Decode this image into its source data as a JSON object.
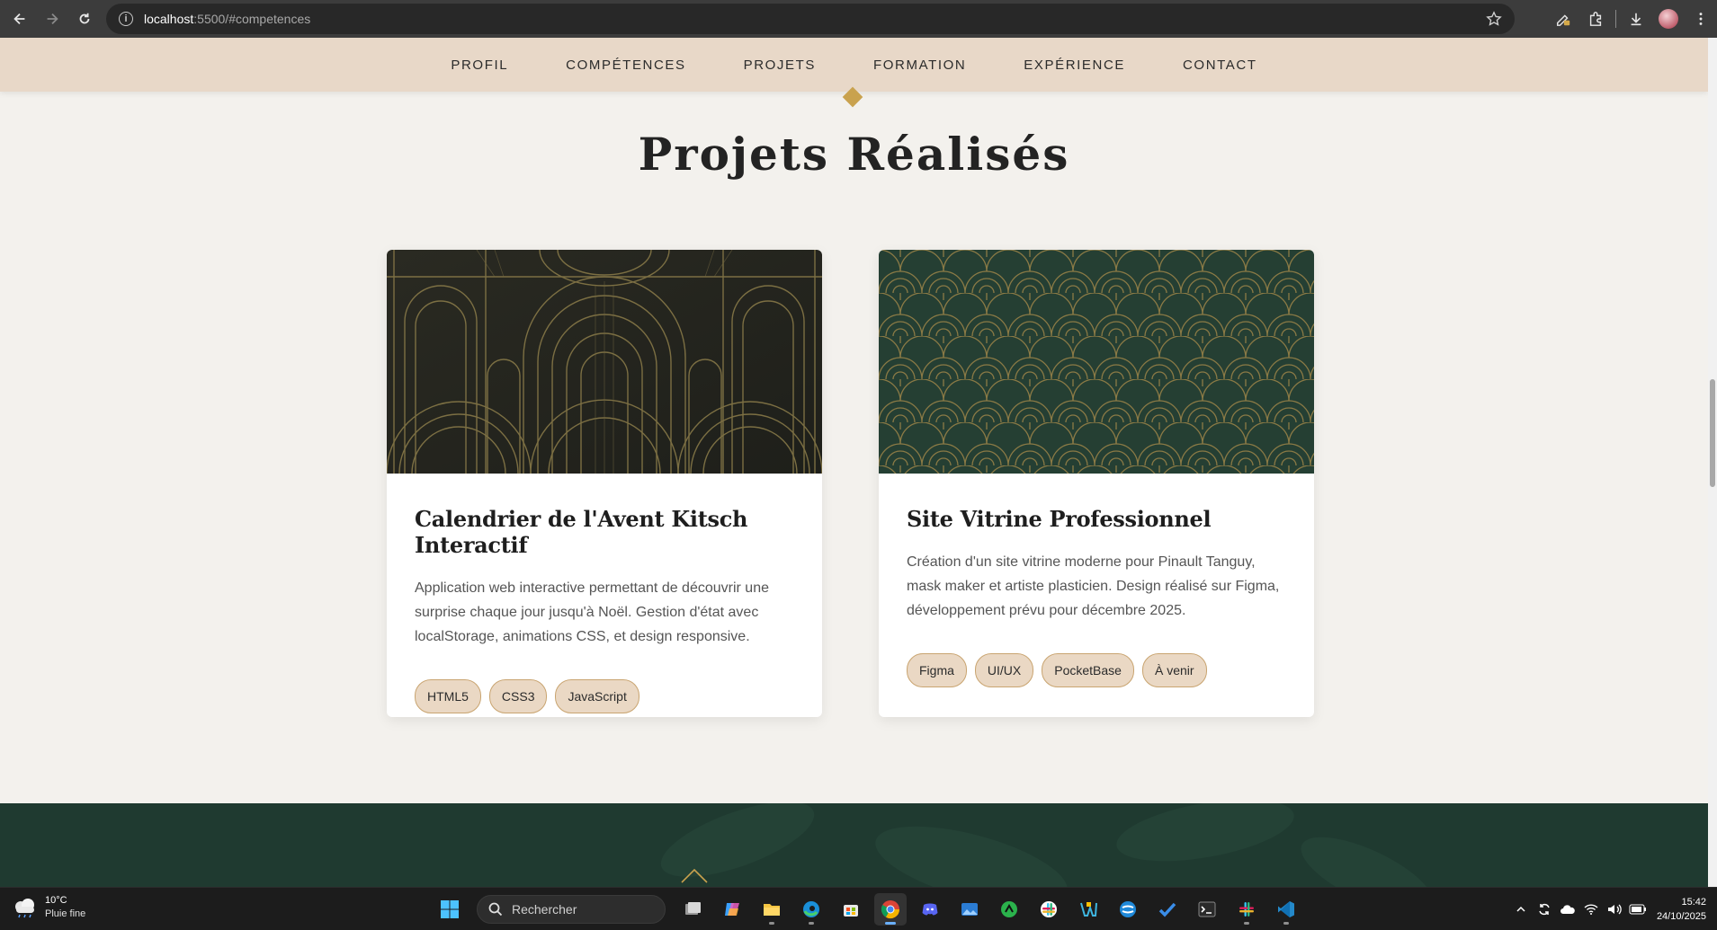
{
  "browser": {
    "url_host": "localhost",
    "url_rest": ":5500/#competences",
    "icons": [
      "back-icon",
      "forward-icon",
      "reload-icon",
      "site-info-icon",
      "bookmark-star-icon",
      "edit-extension-icon",
      "extensions-icon",
      "download-icon",
      "profile-avatar",
      "menu-icon"
    ]
  },
  "nav": {
    "items": [
      "PROFIL",
      "COMPÉTENCES",
      "PROJETS",
      "FORMATION",
      "EXPÉRIENCE",
      "CONTACT"
    ]
  },
  "section": {
    "title": "Projets Réalisés"
  },
  "projects": [
    {
      "title": "Calendrier de l'Avent Kitsch Interactif",
      "description": "Application web interactive permettant de découvrir une surprise chaque jour jusqu'à Noël. Gestion d'état avec localStorage, animations CSS, et design responsive.",
      "tags": [
        "HTML5",
        "CSS3",
        "JavaScript"
      ]
    },
    {
      "title": "Site Vitrine Professionnel",
      "description": "Création d'un site vitrine moderne pour Pinault Tanguy, mask maker et artiste plasticien. Design réalisé sur Figma, développement prévu pour décembre 2025.",
      "tags": [
        "Figma",
        "UI/UX",
        "PocketBase",
        "À venir"
      ]
    }
  ],
  "colors": {
    "nav_bg": "#e8d8c8",
    "gold": "#c9a24e",
    "tag_bg": "#ead8c4",
    "footer_green": "#1f3a30",
    "page_bg": "#f3f1ed"
  },
  "taskbar": {
    "weather_temp": "10°C",
    "weather_cond": "Pluie fine",
    "search_placeholder": "Rechercher",
    "time": "15:42",
    "date": "24/10/2025"
  }
}
